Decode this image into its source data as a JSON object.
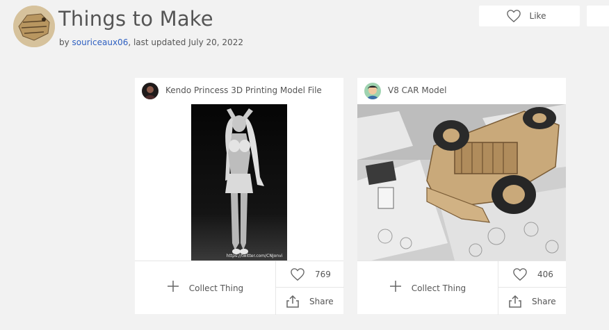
{
  "header": {
    "title": "Things to Make",
    "by_prefix": "by ",
    "author": "souriceaux06",
    "updated_text": ", last updated July 20, 2022",
    "like_label": "Like"
  },
  "cards": [
    {
      "title": "Kendo Princess 3D Printing Model File",
      "image_watermark": "https://twitter.com/CNJonvi",
      "collect_label": "Collect Thing",
      "like_count": "769",
      "share_label": "Share"
    },
    {
      "title": "V8 CAR Model",
      "collect_label": "Collect Thing",
      "like_count": "406",
      "share_label": "Share"
    }
  ],
  "icons": {
    "like": "heart-icon",
    "collect": "plus-icon",
    "share": "share-icon"
  }
}
